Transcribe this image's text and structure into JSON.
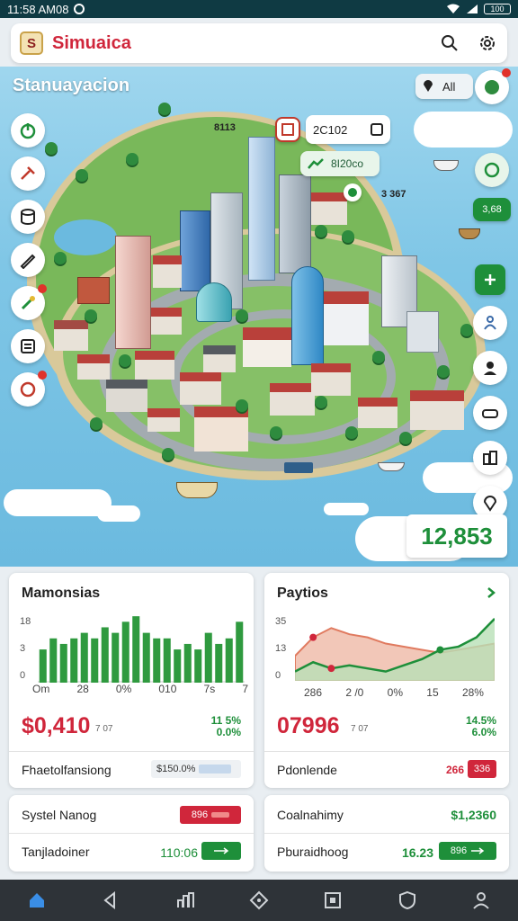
{
  "status_bar": {
    "time": "11:58 AM08",
    "battery": "100"
  },
  "app": {
    "title": "Simuaica",
    "logo_letter": "S"
  },
  "map": {
    "title": "Stanuayacion",
    "labels": {
      "top_small": "8113",
      "chip_value": "2C102",
      "green_chip": "8I20co",
      "side_value": "3 367",
      "filter_label": "All",
      "right_pill": "3,68"
    },
    "counter": "12,853"
  },
  "cards": {
    "left_chart": {
      "title": "Mamonsias",
      "y_ticks": [
        "18",
        "3",
        "0"
      ],
      "x_ticks": [
        "Om",
        "28",
        "0%",
        "010",
        "7s",
        "7"
      ],
      "bar_values": [
        6,
        8,
        7,
        8,
        9,
        8,
        10,
        9,
        11,
        12,
        9,
        8,
        8,
        6,
        7,
        6,
        9,
        7,
        8,
        11
      ],
      "big_value": "$0,410",
      "big_unit": "7 07",
      "pct_top": "11 5%",
      "pct_bottom": "0.0%",
      "row_label": "Fhaetolfansiong",
      "row_value": "$150.0%"
    },
    "right_chart": {
      "title": "Paytios",
      "y_ticks": [
        "35",
        "13",
        "0"
      ],
      "x_ticks": [
        "286",
        "2 /0",
        "0%",
        "15",
        "28%"
      ],
      "series_area": [
        8,
        14,
        17,
        15,
        14,
        12,
        11,
        10,
        9,
        10,
        11,
        12
      ],
      "series_line": [
        3,
        6,
        4,
        5,
        4,
        3,
        5,
        7,
        10,
        11,
        14,
        20
      ],
      "big_value": "07996",
      "big_unit": "7 07",
      "pct_top": "14.5%",
      "pct_bottom": "6.0%",
      "row_label": "Pdonlende",
      "row_value": "266",
      "row_pill": "336"
    },
    "bottom_left": {
      "row1_label": "Systel Nanog",
      "row1_pill": "896",
      "row2_label": "Tanjladoiner",
      "row2_value": "110:06"
    },
    "bottom_right": {
      "row1_label": "Coalnahimy",
      "row1_value": "$1,2360",
      "row2_label": "Pburaidhoog",
      "row2_value": "16.23",
      "row2_pill": "896"
    }
  },
  "colors": {
    "accent_red": "#d0263b",
    "accent_green": "#1e8f3a",
    "nav_bg": "#2e3338"
  },
  "icons": [
    "search-icon",
    "settings-icon",
    "home-icon",
    "back-icon",
    "stats-icon",
    "compass-icon",
    "stop-icon",
    "shield-icon",
    "profile-icon"
  ]
}
